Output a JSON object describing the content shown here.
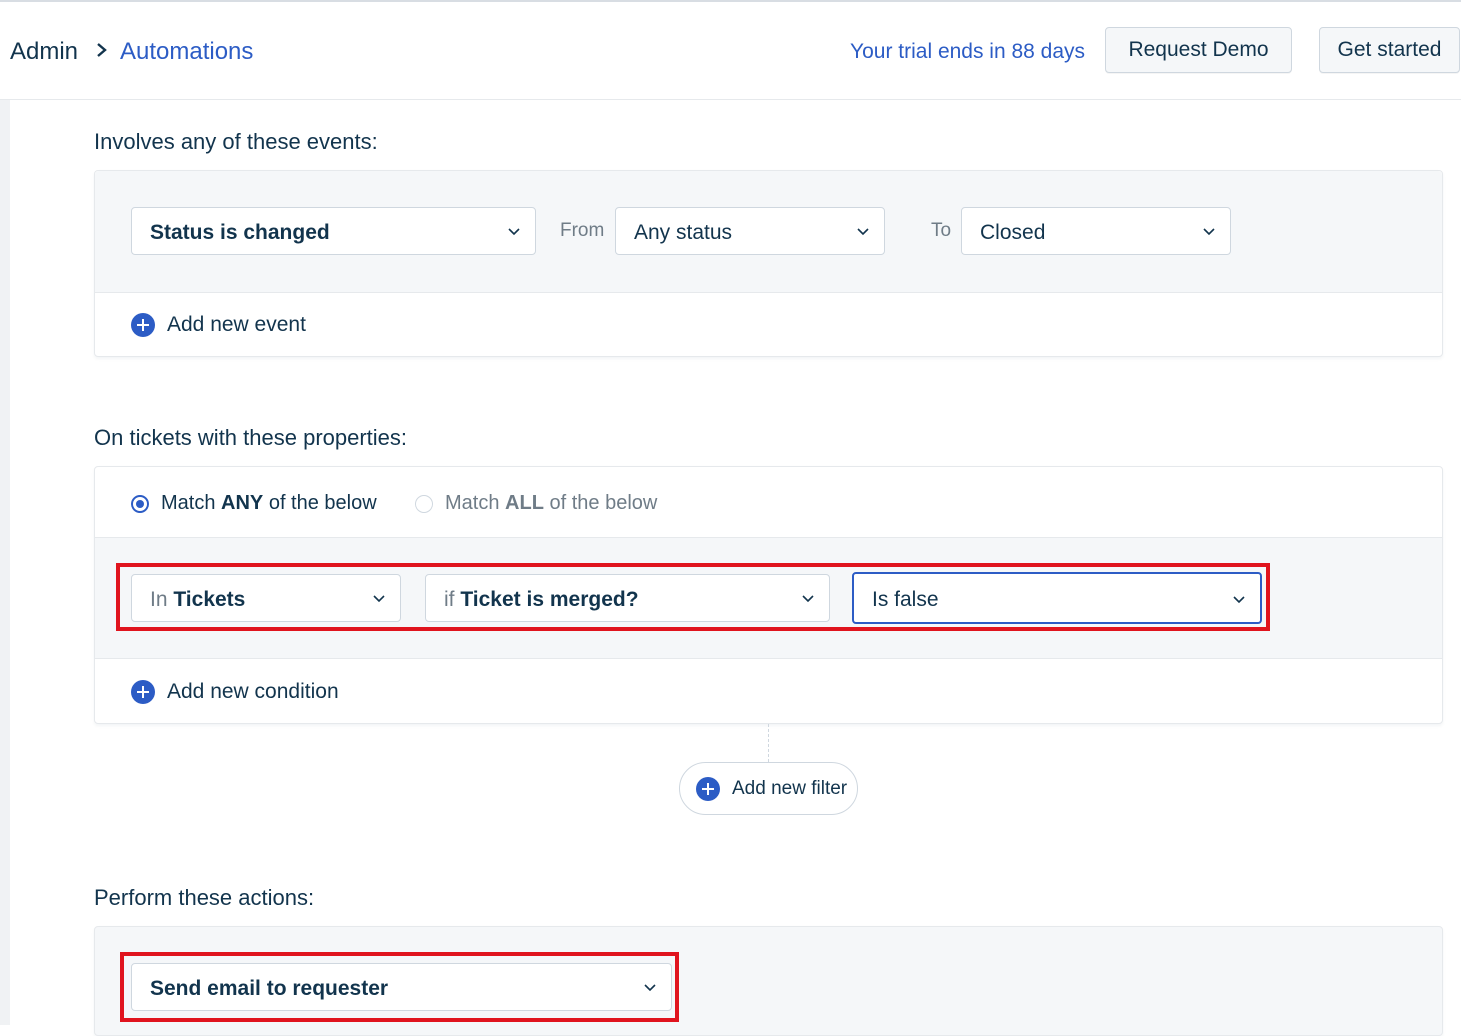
{
  "header": {
    "breadcrumb_root": "Admin",
    "breadcrumb_current": "Automations",
    "trial_text": "Your trial ends in 88 days",
    "request_demo_label": "Request Demo",
    "get_started_label": "Get started"
  },
  "events_section": {
    "title": "Involves any of these events:",
    "event_select": "Status is changed",
    "from_label": "From",
    "from_select": "Any status",
    "to_label": "To",
    "to_select": "Closed",
    "add_event_label": "Add new event"
  },
  "conditions_section": {
    "title": "On tickets with these properties:",
    "match_any": {
      "prefix": "Match ",
      "strong": "ANY",
      "suffix": " of the below",
      "selected": true
    },
    "match_all": {
      "prefix": "Match ",
      "strong": "ALL",
      "suffix": " of the below",
      "selected": false
    },
    "condition": {
      "in_prefix": "In",
      "in_value": "Tickets",
      "if_prefix": "if",
      "if_value": "Ticket is merged?",
      "operator": "Is false"
    },
    "add_condition_label": "Add new condition",
    "add_filter_label": "Add new filter"
  },
  "actions_section": {
    "title": "Perform these actions:",
    "action_select": "Send email to requester"
  },
  "colors": {
    "accent": "#2c5cc5",
    "highlight": "#e0141e",
    "text": "#12344d"
  }
}
